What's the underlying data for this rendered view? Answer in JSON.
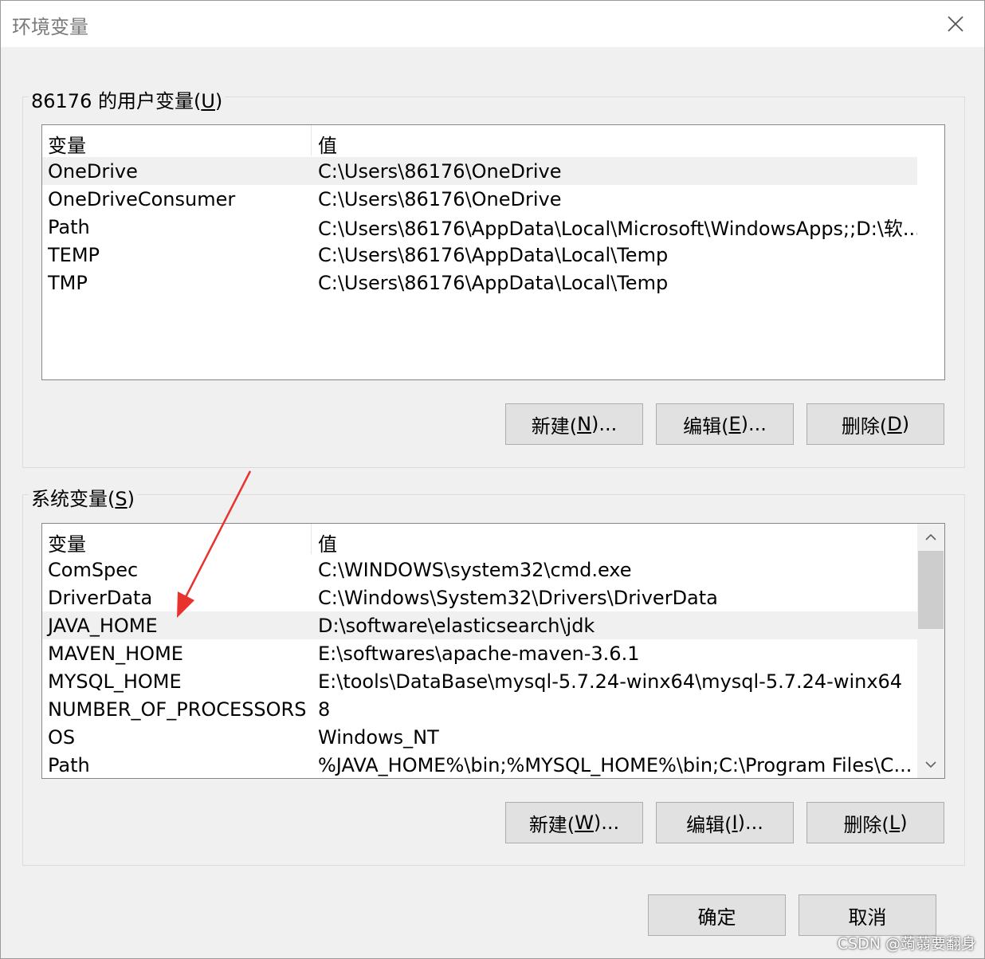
{
  "window": {
    "title": "环境变量"
  },
  "user_vars": {
    "group_label_prefix": "86176 的用户变量(",
    "group_label_key": "U",
    "group_label_suffix": ")",
    "headers": {
      "name": "变量",
      "value": "值"
    },
    "rows": [
      {
        "name": "OneDrive",
        "value": "C:\\Users\\86176\\OneDrive"
      },
      {
        "name": "OneDriveConsumer",
        "value": "C:\\Users\\86176\\OneDrive"
      },
      {
        "name": "Path",
        "value": "C:\\Users\\86176\\AppData\\Local\\Microsoft\\WindowsApps;;D:\\软..."
      },
      {
        "name": "TEMP",
        "value": "C:\\Users\\86176\\AppData\\Local\\Temp"
      },
      {
        "name": "TMP",
        "value": "C:\\Users\\86176\\AppData\\Local\\Temp"
      }
    ],
    "selected_row": "OneDrive",
    "buttons": {
      "new_prefix": "新建(",
      "new_key": "N",
      "new_suffix": ")...",
      "edit_prefix": "编辑(",
      "edit_key": "E",
      "edit_suffix": ")...",
      "delete_prefix": "删除(",
      "delete_key": "D",
      "delete_suffix": ")"
    }
  },
  "system_vars": {
    "group_label_prefix": "系统变量(",
    "group_label_key": "S",
    "group_label_suffix": ")",
    "headers": {
      "name": "变量",
      "value": "值"
    },
    "rows": [
      {
        "name": "ComSpec",
        "value": "C:\\WINDOWS\\system32\\cmd.exe"
      },
      {
        "name": "DriverData",
        "value": "C:\\Windows\\System32\\Drivers\\DriverData"
      },
      {
        "name": "JAVA_HOME",
        "value": "D:\\software\\elasticsearch\\jdk"
      },
      {
        "name": "MAVEN_HOME",
        "value": "E:\\softwares\\apache-maven-3.6.1"
      },
      {
        "name": "MYSQL_HOME",
        "value": "E:\\tools\\DataBase\\mysql-5.7.24-winx64\\mysql-5.7.24-winx64"
      },
      {
        "name": "NUMBER_OF_PROCESSORS",
        "value": "8"
      },
      {
        "name": "OS",
        "value": "Windows_NT"
      },
      {
        "name": "Path",
        "value": "%JAVA_HOME%\\bin;%MYSQL_HOME%\\bin;C:\\Program Files\\C..."
      }
    ],
    "selected_row": "JAVA_HOME",
    "buttons": {
      "new_prefix": "新建(",
      "new_key": "W",
      "new_suffix": ")...",
      "edit_prefix": "编辑(",
      "edit_key": "I",
      "edit_suffix": ")...",
      "delete_prefix": "删除(",
      "delete_key": "L",
      "delete_suffix": ")"
    }
  },
  "footer": {
    "ok_label": "确定",
    "cancel_label": "取消"
  },
  "watermark": "CSDN @蒟蒻要翻身",
  "colors": {
    "annotation_arrow": "#e8322d",
    "selected_row": "#f0f0f0"
  }
}
